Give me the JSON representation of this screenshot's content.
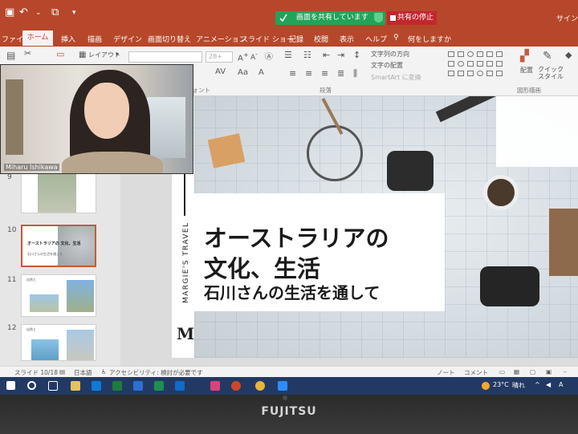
{
  "app": {
    "share_status": "画面を共有しています",
    "stop_share": "共有の停止",
    "signin": "サイン"
  },
  "tabs": [
    "ファイル",
    "ホーム",
    "挿入",
    "描画",
    "デザイン",
    "画面切り替え",
    "アニメーション",
    "スライド ショー",
    "記録",
    "校閲",
    "表示",
    "ヘルプ",
    "何をしますか"
  ],
  "ribbon": {
    "layout": "レイアウト",
    "font_size": "28+",
    "text_direction": "文字列の方向",
    "align_text": "文字の配置",
    "smartart": "SmartArt に変換",
    "arrange": "配置",
    "quick_style": "クイック スタイル",
    "group_font": "フォント",
    "group_paragraph": "段落",
    "group_drawing": "図形描画"
  },
  "video": {
    "name": "Miharu Ishikawa"
  },
  "thumbnails": [
    {
      "num": "9"
    },
    {
      "num": "10",
      "title": "オーストラリアの 文化、生活",
      "sub": "石川さんの生活を通して",
      "selected": true
    },
    {
      "num": "11",
      "title": "自然と"
    },
    {
      "num": "12",
      "title": "自然と"
    }
  ],
  "slide": {
    "vertical": "MARGIE'S TRAVEL",
    "logo": "M",
    "title1": "オーストラリアの",
    "title2": "文化、生活",
    "subtitle": "石川さんの生活を通して"
  },
  "status": {
    "slide_index": "スライド 10/18",
    "language": "日本語",
    "accessibility": "アクセシビリティ: 検討が必要です",
    "notes": "ノート",
    "comments": "コメント"
  },
  "taskbar": {
    "temp": "23°C",
    "weather": "晴れ",
    "lang": "A"
  },
  "brand": "FUJITSU",
  "colors": {
    "ppt_red": "#b7472a",
    "share_green": "#22a35a",
    "stop_red": "#c2262e",
    "taskbar": "#223a63"
  }
}
